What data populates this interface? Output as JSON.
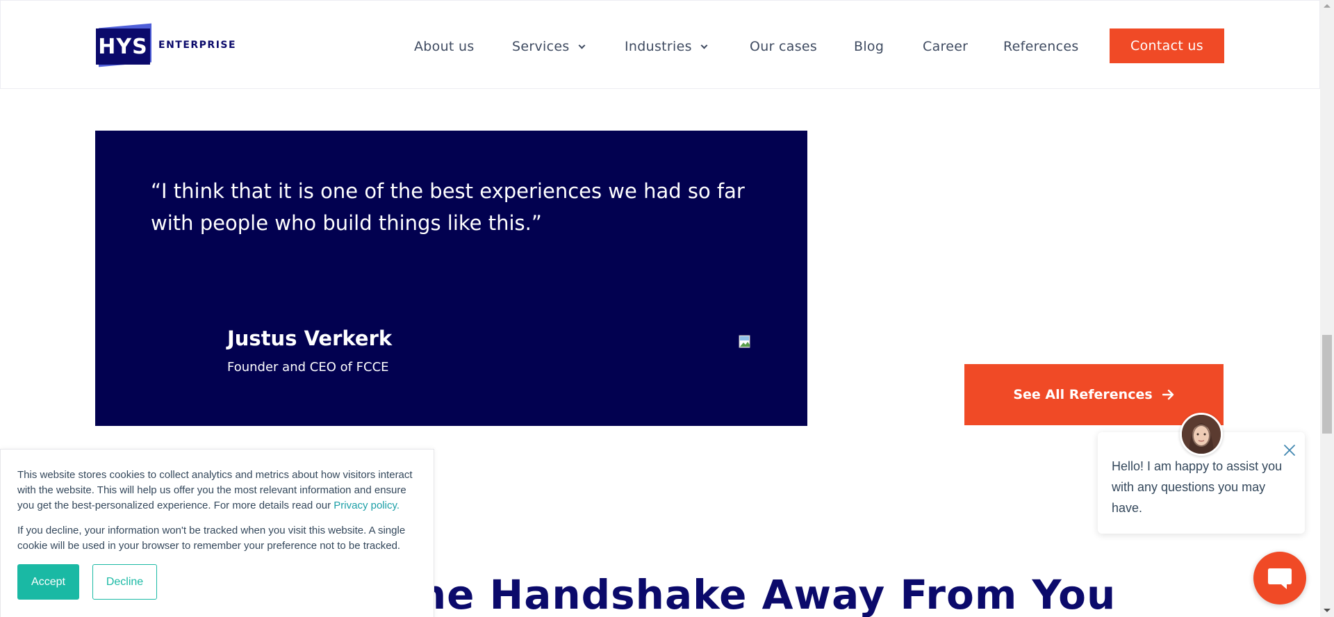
{
  "header": {
    "logo": {
      "mark": "HYS",
      "text": "ENTERPRISE"
    },
    "nav": [
      {
        "label": "About us",
        "has_dropdown": false
      },
      {
        "label": "Services",
        "has_dropdown": true
      },
      {
        "label": "Industries",
        "has_dropdown": true
      },
      {
        "label": "Our cases",
        "has_dropdown": false
      },
      {
        "label": "Blog",
        "has_dropdown": false
      },
      {
        "label": "Career",
        "has_dropdown": false
      },
      {
        "label": "References",
        "has_dropdown": false
      }
    ],
    "contact_label": "Contact us"
  },
  "testimonial": {
    "quote": "“I think that it is one of the best experiences we had so far with people who build things like this.”",
    "name": "Justus Verkerk",
    "role": "Founder and CEO of FCCE"
  },
  "references": {
    "see_all_label": "See All References",
    "icon": "arrow-right-icon"
  },
  "section": {
    "heading_visible": "one Handshake Away From You"
  },
  "cookie_banner": {
    "paragraph1": "This website stores cookies to collect analytics and metrics about how visitors interact with the website. This will help us offer you the most relevant information and ensure you get the best-personalized experience. For more details read our ",
    "privacy_link": "Privacy policy.",
    "paragraph2": "If you decline, your information won't be tracked when you visit this website. A single cookie will be used in your browser to remember your preference not to be tracked.",
    "accept_label": "Accept",
    "decline_label": "Decline"
  },
  "chat": {
    "message": "Hello! I am happy to assist you with any questions you may have."
  },
  "colors": {
    "brand_navy": "#0b0a6b",
    "testimonial_bg": "#020150",
    "accent_orange": "#f04a26",
    "cookie_teal": "#1ab9a4"
  }
}
